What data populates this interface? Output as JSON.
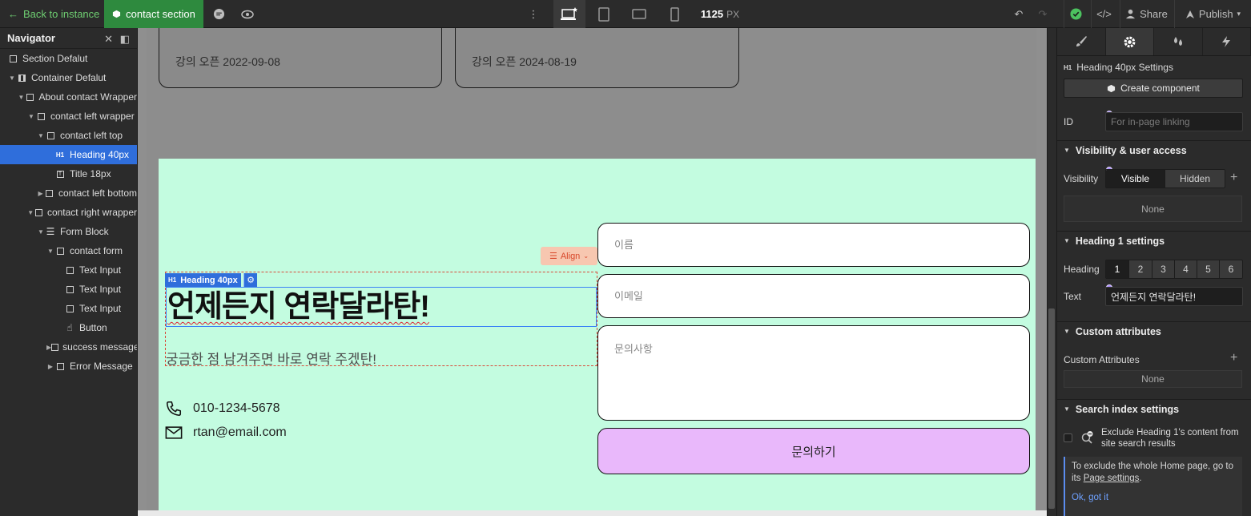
{
  "topbar": {
    "back_label": "Back to instance",
    "crumb_label": "contact section",
    "canvas_width_value": "1125",
    "canvas_width_unit": "PX",
    "share_label": "Share",
    "publish_label": "Publish",
    "status_color": "#2e8a3e"
  },
  "navigator": {
    "title": "Navigator",
    "items": [
      {
        "label": "Section Defalut",
        "icon": "box-icon"
      },
      {
        "label": "Container Defalut",
        "icon": "container-icon"
      },
      {
        "label": "About contact Wrapper",
        "icon": "box-icon"
      },
      {
        "label": "contact left wrapper",
        "icon": "box-icon"
      },
      {
        "label": "contact left top",
        "icon": "box-icon"
      },
      {
        "label": "Heading 40px",
        "icon": "heading-icon"
      },
      {
        "label": "Title 18px",
        "icon": "text-icon"
      },
      {
        "label": "contact left bottom",
        "icon": "box-icon"
      },
      {
        "label": "contact right wrapper",
        "icon": "box-icon"
      },
      {
        "label": "Form Block",
        "icon": "form-icon"
      },
      {
        "label": "contact form",
        "icon": "box-icon"
      },
      {
        "label": "Text Input",
        "icon": "box-icon"
      },
      {
        "label": "Text Input",
        "icon": "box-icon"
      },
      {
        "label": "Text Input",
        "icon": "box-icon"
      },
      {
        "label": "Button",
        "icon": "pointer-icon"
      },
      {
        "label": "success message",
        "icon": "box-icon"
      },
      {
        "label": "Error Message",
        "icon": "box-icon"
      }
    ]
  },
  "canvas": {
    "card1_text": "강의 오픈 2022-09-08",
    "card2_text": "강의 오픈 2024-08-19",
    "heading_tag": "H1",
    "heading_label": "Heading 40px",
    "align_label": "Align",
    "heading": "언제든지 연락달라탄!",
    "subtitle": "궁금한 점 남겨주면 바로 연락 주겠탄!",
    "phone": "010-1234-5678",
    "email": "rtan@email.com",
    "form": {
      "name_placeholder": "이름",
      "email_placeholder": "이메일",
      "message_placeholder": "문의사항",
      "submit_label": "문의하기"
    },
    "section_bg": "#c3fce0",
    "submit_bg": "#e9b8fb"
  },
  "panel": {
    "settings_title": "Heading 40px Settings",
    "heading_tag": "H1",
    "create_component": "Create component",
    "id_label": "ID",
    "id_placeholder": "For in-page linking",
    "visibility_section": "Visibility & user access",
    "visibility_label": "Visibility",
    "visible": "Visible",
    "hidden": "Hidden",
    "none": "None",
    "heading_settings_section": "Heading 1 settings",
    "heading_label": "Heading",
    "heading_levels": [
      "1",
      "2",
      "3",
      "4",
      "5",
      "6"
    ],
    "text_label": "Text",
    "text_value": "언제든지 연락달라탄!",
    "custom_attributes_section": "Custom attributes",
    "custom_attributes_label": "Custom Attributes",
    "search_section": "Search index settings",
    "exclude_text": "Exclude Heading 1's content from site search results",
    "notice_text_1": "To exclude the whole Home page, go to its",
    "notice_link": "Page settings",
    "notice_text_2": ".",
    "ok_label": "Ok, got it"
  }
}
